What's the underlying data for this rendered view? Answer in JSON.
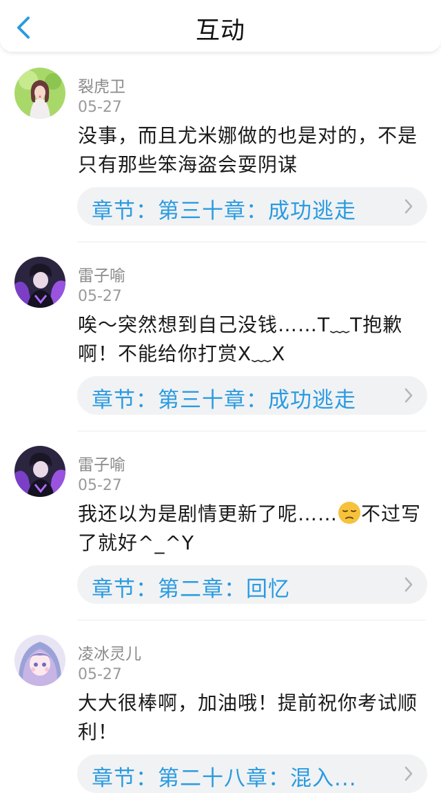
{
  "header": {
    "title": "互动",
    "back_icon": "chevron-left-icon",
    "accent": "#2a9be0"
  },
  "comments": [
    {
      "username": "裂虎卫",
      "date": "05-27",
      "text": "没事，而且尤米娜做的也是对的，不是只有那些笨海盗会耍阴谋",
      "chapter": "章节：第三十章：成功逃走",
      "avatar": "avatar-girl-green-background"
    },
    {
      "username": "雷子喻",
      "date": "05-27",
      "text": "唉～突然想到自己没钱……T﹏T抱歉啊！不能给你打赏X﹏X",
      "chapter": "章节：第三十章：成功逃走",
      "avatar": "avatar-anime-purple-dark"
    },
    {
      "username": "雷子喻",
      "date": "05-27",
      "text_before_emoji": "我还以为是剧情更新了呢……",
      "emoji": "pensive-face-emoji",
      "text_after_emoji": "不过写了就好^_^Y",
      "chapter": "章节：第二章：回忆",
      "avatar": "avatar-anime-purple-dark"
    },
    {
      "username": "凌冰灵儿",
      "date": "05-27",
      "text": "大大很棒啊，加油哦！提前祝你考试顺利！",
      "chapter": "章节：第二十八章：混入...",
      "avatar": "avatar-anime-girl-pastel"
    }
  ]
}
